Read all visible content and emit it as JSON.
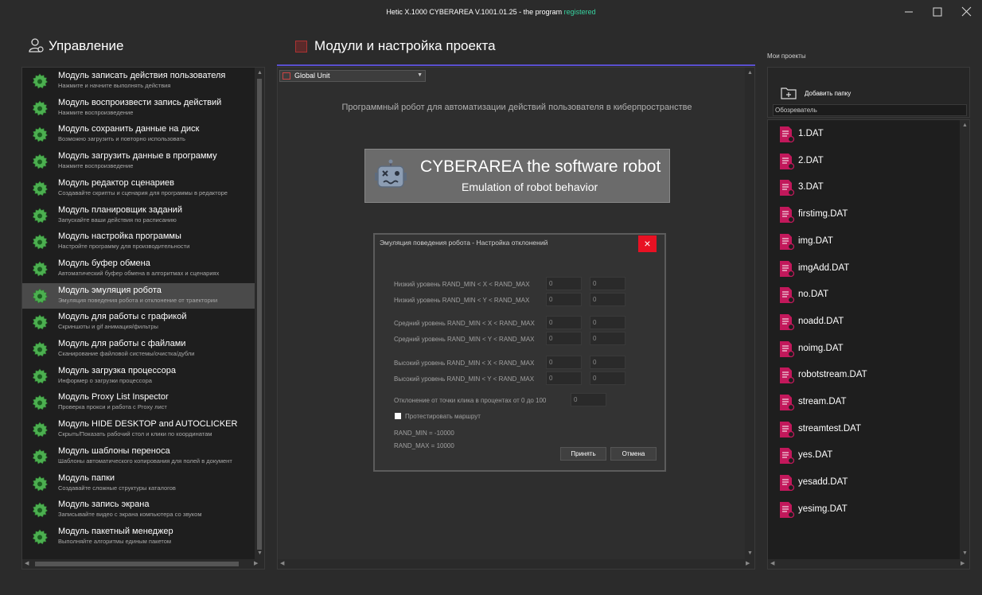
{
  "window": {
    "title_prefix": "Hetic X.1000 CYBERAREA V.1001.01.25 - the program ",
    "title_status": "registered"
  },
  "left": {
    "title": "Управление",
    "modules": [
      {
        "name": "Модуль записать действия пользователя",
        "desc": "Нажмите и начните выполнять действия"
      },
      {
        "name": "Модуль воспроизвести запись действий",
        "desc": "Нажмите воспроизведение"
      },
      {
        "name": "Модуль сохранить данные на диск",
        "desc": "Возможно загрузить и повторно использовать"
      },
      {
        "name": "Модуль загрузить данные в программу",
        "desc": "Нажмите воспроизведение"
      },
      {
        "name": "Модуль редактор сценариев",
        "desc": "Создавайте скрипты и сценария для программы в редакторе"
      },
      {
        "name": "Модуль планировщик заданий",
        "desc": "Запускайте ваши действия по расписанию"
      },
      {
        "name": "Модуль настройка программы",
        "desc": "Настройте программу для производительности"
      },
      {
        "name": "Модуль буфер обмена",
        "desc": "Автоматический буфер обмена в алгоритмах и сценариях"
      },
      {
        "name": "Модуль эмуляция робота",
        "desc": "Эмуляция поведения робота и отклонение от траектории"
      },
      {
        "name": "Модуль для работы с графикой",
        "desc": "Скриншоты и gif анимация/фильтры"
      },
      {
        "name": "Модуль для работы с файлами",
        "desc": "Сканирование файловой системы/очистка/дубли"
      },
      {
        "name": "Модуль загрузка процессора",
        "desc": "Информер о загрузки процессора"
      },
      {
        "name": "Модуль Proxy List Inspector",
        "desc": "Проверка прокси и работа с Proxy лист"
      },
      {
        "name": "Модуль HIDE DESKTOP and AUTOCLICKER",
        "desc": "Скрыть/Показать рабочий стол и клики по координатам"
      },
      {
        "name": "Модуль шаблоны переноса",
        "desc": "Шаблоны автоматического копирования для полей в документ"
      },
      {
        "name": "Модуль папки",
        "desc": "Создавайте сложные структуры каталогов"
      },
      {
        "name": "Модуль запись экрана",
        "desc": "Записывайте видео с экрана компьютера со звуком"
      },
      {
        "name": "Модуль пакетный менеджер",
        "desc": "Выполняйте алгоритмы единым пакетом"
      }
    ]
  },
  "center": {
    "title": "Модули и настройка проекта",
    "unit_select": "Global Unit",
    "subtitle": "Программный робот для автоматизации действий пользователя в киберпространстве",
    "banner_title": "CYBERAREA the software robot",
    "banner_sub": "Emulation of robot behavior",
    "dialog": {
      "title": "Эмуляция поведения робота - Настройка отклонений",
      "close": "×",
      "rows": [
        {
          "label": "Низкий уровень RAND_MIN < X < RAND_MAX",
          "min": "0",
          "max": "0"
        },
        {
          "label": "Низкий уровень RAND_MIN < Y < RAND_MAX",
          "min": "0",
          "max": "0"
        },
        {
          "label": "Средний уровень RAND_MIN < X < RAND_MAX",
          "min": "0",
          "max": "0"
        },
        {
          "label": "Средний уровень RAND_MIN < Y < RAND_MAX",
          "min": "0",
          "max": "0"
        },
        {
          "label": "Высокий уровень RAND_MIN < X < RAND_MAX",
          "min": "0",
          "max": "0"
        },
        {
          "label": "Высокий уровень RAND_MIN < Y < RAND_MAX",
          "min": "0",
          "max": "0"
        }
      ],
      "deviation_label": "Отклонение от точки клика в процентах от 0 до 100",
      "deviation_value": "0",
      "test_route": "Протестировать маршрут",
      "rand_min": "RAND_MIN = -10000",
      "rand_max": "RAND_MAX = 10000",
      "accept": "Принять",
      "cancel": "Отмена"
    }
  },
  "right": {
    "title": "Мои проекты",
    "add_folder": "Добавить папку",
    "explorer": "Обозреватель",
    "files": [
      "1.DAT",
      "2.DAT",
      "3.DAT",
      "firstimg.DAT",
      "img.DAT",
      "imgAdd.DAT",
      "no.DAT",
      "noadd.DAT",
      "noimg.DAT",
      "robotstream.DAT",
      "stream.DAT",
      "streamtest.DAT",
      "yes.DAT",
      "yesadd.DAT",
      "yesimg.DAT"
    ]
  },
  "colors": {
    "accent_line": "#5a4fcf",
    "registered": "#38d3a0",
    "gear": "#4caf50",
    "file_icon": "#c2185b",
    "close": "#e81123"
  }
}
